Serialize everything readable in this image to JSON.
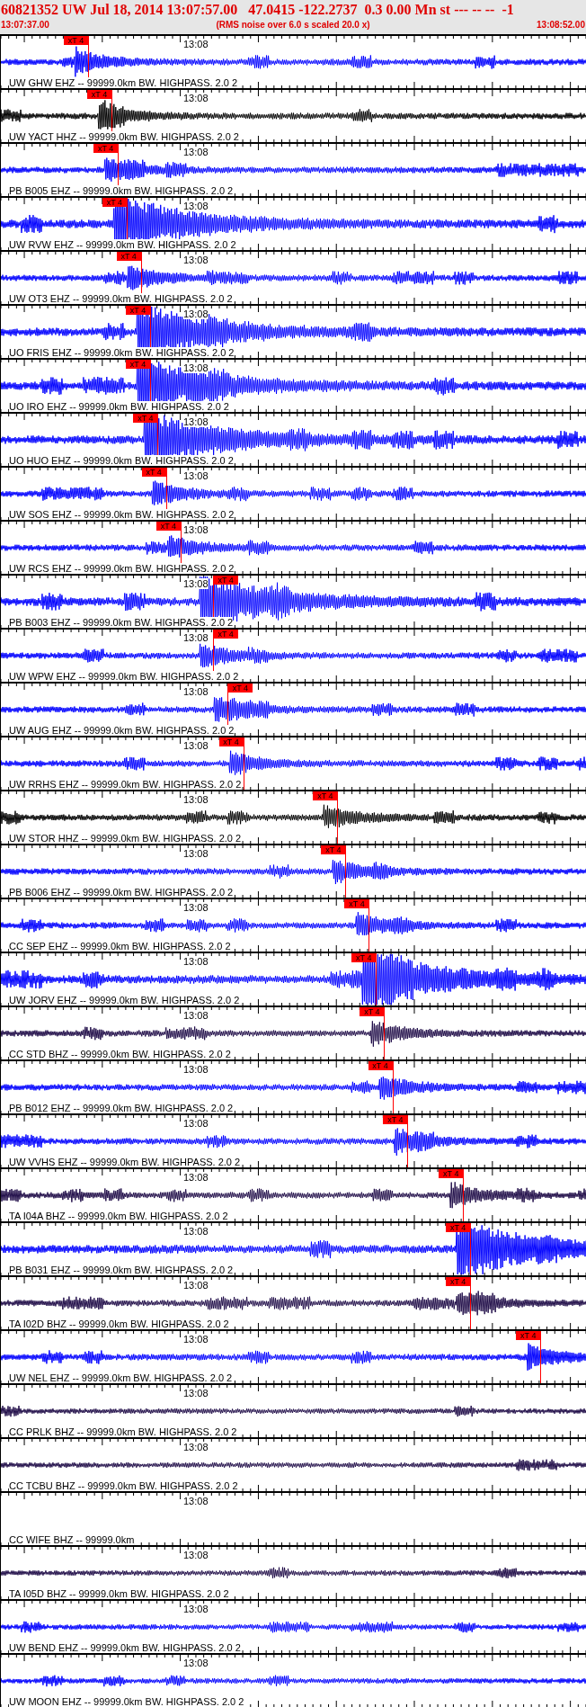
{
  "header": {
    "title": "60821352 UW Jul 18, 2014 13:07:57.00   47.0415 -122.2737  0.3 0.00 Mn st --- -- --  -1",
    "start_time": "13:07:37.00",
    "note": "(RMS noise over 6.0 s scaled 20.0 x)",
    "end_time": "13:08:52.00"
  },
  "traces": [
    {
      "label": "UW GHW EHZ -- 99999.0km BW. HIGHPASS. 2.0 2",
      "time_label": "13:08",
      "color": "#0000ff",
      "kind": "normal",
      "pick": {
        "label": "xT 4",
        "level": 0.149
      }
    },
    {
      "label": "UW YACT HHZ -- 99999.0km BW. HIGHPASS. 2.0 2",
      "time_label": "13:08",
      "color": "#000000",
      "kind": "normal",
      "pick": {
        "label": "xT 4",
        "level": 0.189
      }
    },
    {
      "label": "PB B005 EHZ -- 99999.0km BW. HIGHPASS. 2.0 2",
      "time_label": "13:08",
      "color": "#0000ff",
      "kind": "normal",
      "pick": {
        "label": "xT 4",
        "level": 0.2
      }
    },
    {
      "label": "UW RVW EHZ -- 99999.0km BW. HIGHPASS. 2.0 2",
      "time_label": "13:08",
      "color": "#0000ff",
      "kind": "strong",
      "pick": {
        "label": "xT 4",
        "level": 0.215
      }
    },
    {
      "label": "UW OT3 EHZ -- 99999.0km BW. HIGHPASS. 2.0 2",
      "time_label": "13:08",
      "color": "#0000ff",
      "kind": "normal",
      "pick": {
        "label": "xT 4",
        "level": 0.239
      }
    },
    {
      "label": "UO FRIS EHZ -- 99999.0km BW. HIGHPASS. 2.0 2",
      "time_label": "13:08",
      "color": "#0000ff",
      "kind": "strong",
      "pick": {
        "label": "xT 4",
        "level": 0.255
      }
    },
    {
      "label": "UO IRO EHZ -- 99999.0km BW. HIGHPASS. 2.0 2",
      "time_label": "13:08",
      "color": "#0000ff",
      "kind": "strong",
      "pick": {
        "label": "xT 4",
        "level": 0.255
      }
    },
    {
      "label": "UO HUO EHZ -- 99999.0km BW. HIGHPASS. 2.0 2",
      "time_label": "13:08",
      "color": "#0000ff",
      "kind": "strong",
      "pick": {
        "label": "xT 4",
        "level": 0.268
      }
    },
    {
      "label": "UW SOS EHZ -- 99999.0km BW. HIGHPASS. 2.0 2",
      "time_label": "13:08",
      "color": "#0000ff",
      "kind": "normal",
      "pick": {
        "label": "xT 4",
        "level": 0.282
      }
    },
    {
      "label": "UW RCS EHZ -- 99999.0km BW. HIGHPASS. 2.0 2",
      "time_label": "13:08",
      "color": "#0000ff",
      "kind": "normal",
      "pick": {
        "label": "xT 4",
        "level": 0.307
      }
    },
    {
      "label": "PB B003 EHZ -- 99999.0km BW. HIGHPASS. 2.0 2",
      "time_label": "13:08",
      "color": "#0000ff",
      "kind": "strong",
      "pick": {
        "label": "xT 4",
        "level": 0.362
      }
    },
    {
      "label": "UW WPW EHZ -- 99999.0km BW. HIGHPASS. 2.0 2",
      "time_label": "13:08",
      "color": "#0000ff",
      "kind": "normal",
      "pick": {
        "label": "xT 4",
        "level": 0.362
      }
    },
    {
      "label": "UW AUG EHZ -- 99999.0km BW. HIGHPASS. 2.0 2",
      "time_label": "13:08",
      "color": "#0000ff",
      "kind": "normal",
      "pick": {
        "label": "xT 4",
        "level": 0.387
      }
    },
    {
      "label": "UW RRHS EHZ -- 99999.0km BW. HIGHPASS. 2.0 2",
      "time_label": "13:08",
      "color": "#0000ff",
      "kind": "normal",
      "pick": {
        "label": "xT 4",
        "level": 0.414
      }
    },
    {
      "label": "UW STOR HHZ -- 99999.0km BW. HIGHPASS. 2.0 2",
      "time_label": "13:08",
      "color": "#000000",
      "kind": "normal",
      "pick": {
        "label": "xT 4",
        "level": 0.575
      }
    },
    {
      "label": "PB B006 EHZ -- 99999.0km BW. HIGHPASS. 2.0 2",
      "time_label": "13:08",
      "color": "#0000ff",
      "kind": "normal",
      "pick": {
        "label": "xT 4",
        "level": 0.589
      }
    },
    {
      "label": "CC SEP EHZ -- 99999.0km BW. HIGHPASS. 2.0 2",
      "time_label": "13:08",
      "color": "#0000ff",
      "kind": "normal",
      "pick": {
        "label": "xT 4",
        "level": 0.629
      }
    },
    {
      "label": "UW JORV EHZ -- 99999.0km BW. HIGHPASS. 2.0 2",
      "time_label": "13:08",
      "color": "#0000ff",
      "kind": "strong",
      "pick": {
        "label": "xT 4",
        "level": 0.641
      }
    },
    {
      "label": "CC STD BHZ -- 99999.0km BW. HIGHPASS. 2.0 2",
      "time_label": "13:08",
      "color": "#1e0a46",
      "kind": "normal",
      "pick": {
        "label": "xT 4",
        "level": 0.655
      }
    },
    {
      "label": "PB B012 EHZ -- 99999.0km BW. HIGHPASS. 2.0 2",
      "time_label": "13:08",
      "color": "#0000ff",
      "kind": "normal",
      "pick": {
        "label": "xT 4",
        "level": 0.669
      }
    },
    {
      "label": "UW VVHS EHZ -- 99999.0km BW. HIGHPASS. 2.0 2",
      "time_label": "13:08",
      "color": "#0000ff",
      "kind": "normal",
      "pick": {
        "label": "xT 4",
        "level": 0.695
      }
    },
    {
      "label": "TA I04A BHZ -- 99999.0km BW. HIGHPASS. 2.0 2",
      "time_label": "13:08",
      "color": "#1e0a46",
      "kind": "normal",
      "pick": {
        "label": "xT 4",
        "level": 0.79
      }
    },
    {
      "label": "PB B031 EHZ -- 99999.0km BW. HIGHPASS. 2.0 2",
      "time_label": "13:08",
      "color": "#0000ff",
      "kind": "strong",
      "pick": {
        "label": "xT 4",
        "level": 0.802
      }
    },
    {
      "label": "TA I02D BHZ -- 99999.0km BW. HIGHPASS. 2.0 2",
      "time_label": "13:08",
      "color": "#1e0a46",
      "kind": "normal",
      "pick": {
        "label": "xT 4",
        "level": 0.802
      }
    },
    {
      "label": "UW NEL EHZ -- 99999.0km BW. HIGHPASS. 2.0 2",
      "time_label": "13:08",
      "color": "#0000ff",
      "kind": "normal",
      "pick": {
        "label": "xT 4",
        "level": 0.922
      }
    },
    {
      "label": "CC PRLK BHZ -- 99999.0km BW. HIGHPASS. 2.0 2",
      "time_label": "13:08",
      "color": "#1e0a46",
      "kind": "quiet"
    },
    {
      "label": "CC TCBU BHZ -- 99999.0km BW. HIGHPASS. 2.0 2",
      "time_label": "13:08",
      "color": "#1e0a46",
      "kind": "quiet"
    },
    {
      "label": "CC WIFE BHZ -- 99999.0km",
      "time_label": "13:08",
      "kind": "flat"
    },
    {
      "label": "TA I05D BHZ -- 99999.0km BW. HIGHPASS. 2.0 2",
      "time_label": "13:08",
      "color": "#1e0a46",
      "kind": "quiet"
    },
    {
      "label": "UW BEND EHZ -- 99999.0km BW. HIGHPASS. 2.0 2",
      "time_label": "13:08",
      "color": "#0000ff",
      "kind": "quiet"
    },
    {
      "label": "UW MOON EHZ -- 99999.0km BW. HIGHPASS. 2.0 2",
      "time_label": "13:08",
      "color": "#0000ff",
      "kind": "quiet"
    }
  ]
}
